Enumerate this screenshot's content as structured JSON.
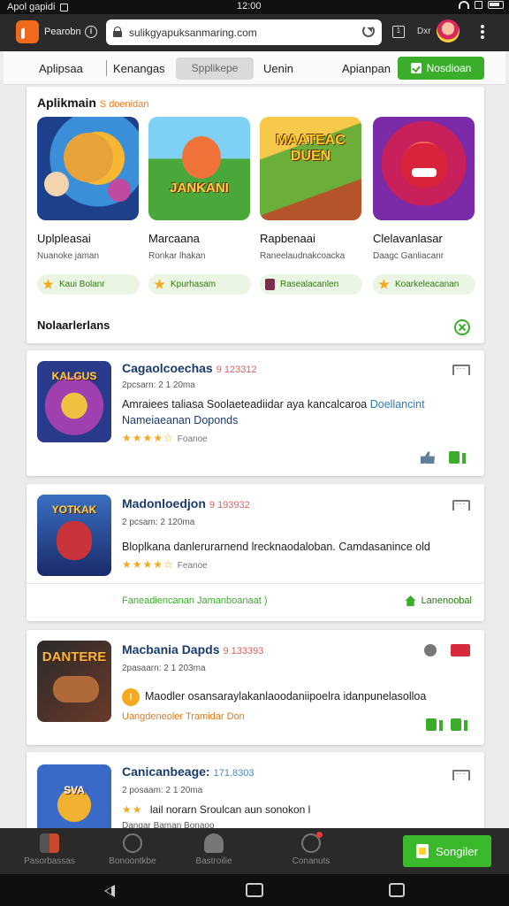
{
  "status_bar": {
    "left_text": "Apol gapidi",
    "time": "12:00"
  },
  "browser": {
    "app_name": "Pearobn",
    "url": "sulikgyapuksanmaring.com",
    "user_label": "Dxr"
  },
  "nav": {
    "items": [
      "Aplipsaa",
      "Kenangas",
      "Spplikepe",
      "Uenin",
      "Apianpan"
    ],
    "button_label": "Nosdioan"
  },
  "featured": {
    "title": "Aplikmain",
    "subtitle": "S doenidan",
    "apps": [
      {
        "thumb_text": "",
        "name": "Uplpleasai",
        "desc": "Nuanoke jaman",
        "tag": "Kaui Bolanr",
        "tag_icon": "star-icon"
      },
      {
        "thumb_text": "JANKANI",
        "name": "Marcaana",
        "desc": "Ronkar lhakan",
        "tag": "Kpurhasam",
        "tag_icon": "star-icon"
      },
      {
        "thumb_text": "MAATEAC DUEN",
        "name": "Rapbenaai",
        "desc": "Raneelaudnakcoacka",
        "tag": "Rasealacanlen",
        "tag_icon": "badge-icon"
      },
      {
        "thumb_text": "",
        "name": "Clelavanlasar",
        "desc": "Daagc Ganliacanr",
        "tag": "Koarkeleacanan",
        "tag_icon": "star-icon"
      }
    ],
    "footer": "Nolaarlerlans"
  },
  "cards": [
    {
      "thumb_text": "KALGUS",
      "title": "Cagaolcoechas",
      "code": "9 123312",
      "meta": "2pcsarn: 2 1 20ma",
      "text": "Amraiees taliasa Soolaeteadiidar aya kancalcaroa",
      "link": "Doellancint",
      "text2": "Nameiaeanan Doponds",
      "stars": "★★★★☆",
      "rating_label": "Foanoe"
    },
    {
      "thumb_text": "YOTKAK",
      "title": "Madonloedjon",
      "code": "9 193932",
      "meta": "2 pcsam: 2 120ma",
      "text": "Bloplkana danlerurarnend lrecknaodaloban. Camdasanince old",
      "stars": "★★★★☆",
      "rating_label": "Feanoe",
      "foot_left": "Faneadiencanan  Jamanboanaat  )",
      "foot_right": "Lanenoobal"
    },
    {
      "thumb_text": "DANTERE",
      "title": "Macbania Dapds",
      "code": "9 133393",
      "meta": "2pasaarn: 2 1 203ma",
      "text": "Maodler osansaraylakanlaoodaniipoelra idanpunelasolloa",
      "orange": "Uangdeneoler  Tramidar Don"
    },
    {
      "thumb_text": "SVA",
      "title": "Canicanbeage:",
      "code": "171.8303",
      "meta": "2 posaam: 2 1 20ma",
      "text": "lail norarn Sroulcan aun sonokon l",
      "text2": "Dangar Baman Bonaoo",
      "stars": "★★"
    }
  ],
  "bottom_nav": {
    "items": [
      "Pasorbassas",
      "Bonoontkbe",
      "Bastroilie",
      "Conanuts"
    ],
    "install_label": "Songiler"
  }
}
